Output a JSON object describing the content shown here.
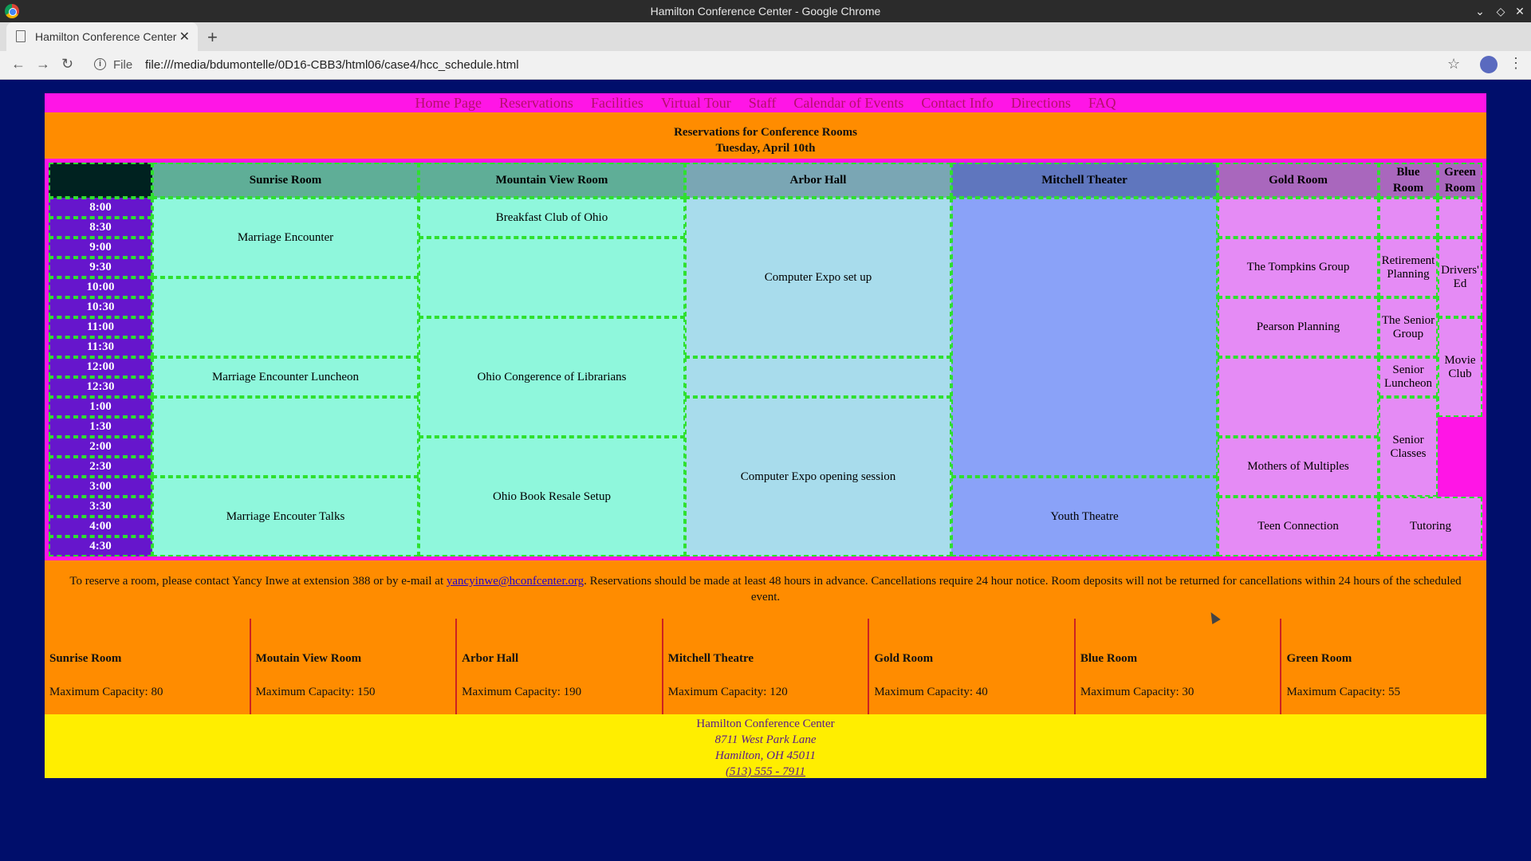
{
  "browser": {
    "window_title": "Hamilton Conference Center - Google Chrome",
    "tab_title": "Hamilton Conference Center",
    "url_scheme": "File",
    "url": "file:///media/bdumontelle/0D16-CBB3/html06/case4/hcc_schedule.html"
  },
  "nav": [
    "Home Page",
    "Reservations",
    "Facilities",
    "Virtual Tour",
    "Staff",
    "Calendar of Events",
    "Contact Info",
    "Directions",
    "FAQ"
  ],
  "header": {
    "line1": "Reservations for Conference Rooms",
    "line2": "Tuesday, April 10th"
  },
  "rooms": {
    "sunrise": "Sunrise Room",
    "mountain": "Mountain View Room",
    "arbor": "Arbor Hall",
    "mitchell": "Mitchell Theater",
    "gold": "Gold Room",
    "blue": "Blue Room",
    "green": "Green Room"
  },
  "times": [
    "8:00",
    "8:30",
    "9:00",
    "9:30",
    "10:00",
    "10:30",
    "11:00",
    "11:30",
    "12:00",
    "12:30",
    "1:00",
    "1:30",
    "2:00",
    "2:30",
    "3:00",
    "3:30",
    "4:00",
    "4:30"
  ],
  "events": {
    "marriage_encounter": "Marriage Encounter",
    "marriage_luncheon": "Marriage Encounter Luncheon",
    "marriage_talks": "Marriage Encouter Talks",
    "breakfast_club": "Breakfast Club of Ohio",
    "librarians": "Ohio Congerence of Librarians",
    "book_resale": "Ohio Book Resale Setup",
    "expo_setup": "Computer Expo set up",
    "expo_opening": "Computer Expo opening session",
    "youth_theatre": "Youth Theatre",
    "tompkins": "The Tompkins Group",
    "pearson": "Pearson Planning",
    "mothers": "Mothers of Multiples",
    "teen": "Teen Connection",
    "retirement": "Retirement Planning",
    "senior_group": "The Senior Group",
    "senior_luncheon": "Senior Luncheon",
    "senior_classes": "Senior Classes",
    "drivers_ed": "Drivers' Ed",
    "movie_club": "Movie Club",
    "tutoring": "Tutoring"
  },
  "notice": {
    "before": "To reserve a room, please contact Yancy Inwe at extension 388 or by e-mail at ",
    "email": "yancyinwe@hconfcenter.org",
    "after": ". Reservations should be made at least 48 hours in advance. Cancellations require 24 hour notice. Room deposits will not be returned for cancellations within 24 hours of the scheduled event."
  },
  "capacities": [
    {
      "name": "Sunrise Room",
      "capacity": "Maximum Capacity: 80"
    },
    {
      "name": "Moutain View Room",
      "capacity": "Maximum Capacity: 150"
    },
    {
      "name": "Arbor Hall",
      "capacity": "Maximum Capacity: 190"
    },
    {
      "name": "Mitchell Theatre",
      "capacity": "Maximum Capacity: 120"
    },
    {
      "name": "Gold Room",
      "capacity": "Maximum Capacity: 40"
    },
    {
      "name": "Blue Room",
      "capacity": "Maximum Capacity: 30"
    },
    {
      "name": "Green Room",
      "capacity": "Maximum Capacity: 55"
    }
  ],
  "footer": {
    "name": "Hamilton Conference Center",
    "street": "8711 West Park Lane",
    "city": "Hamilton, OH 45011",
    "phone": "(513) 555 - 7911"
  },
  "colors": {
    "page_bg": "#000e6b",
    "nav_bg": "#ff15e6",
    "header_bg": "#ff8c00",
    "time_bg": "#6616cc",
    "border": "#2ee02e",
    "footer_bg": "#ffee00"
  }
}
